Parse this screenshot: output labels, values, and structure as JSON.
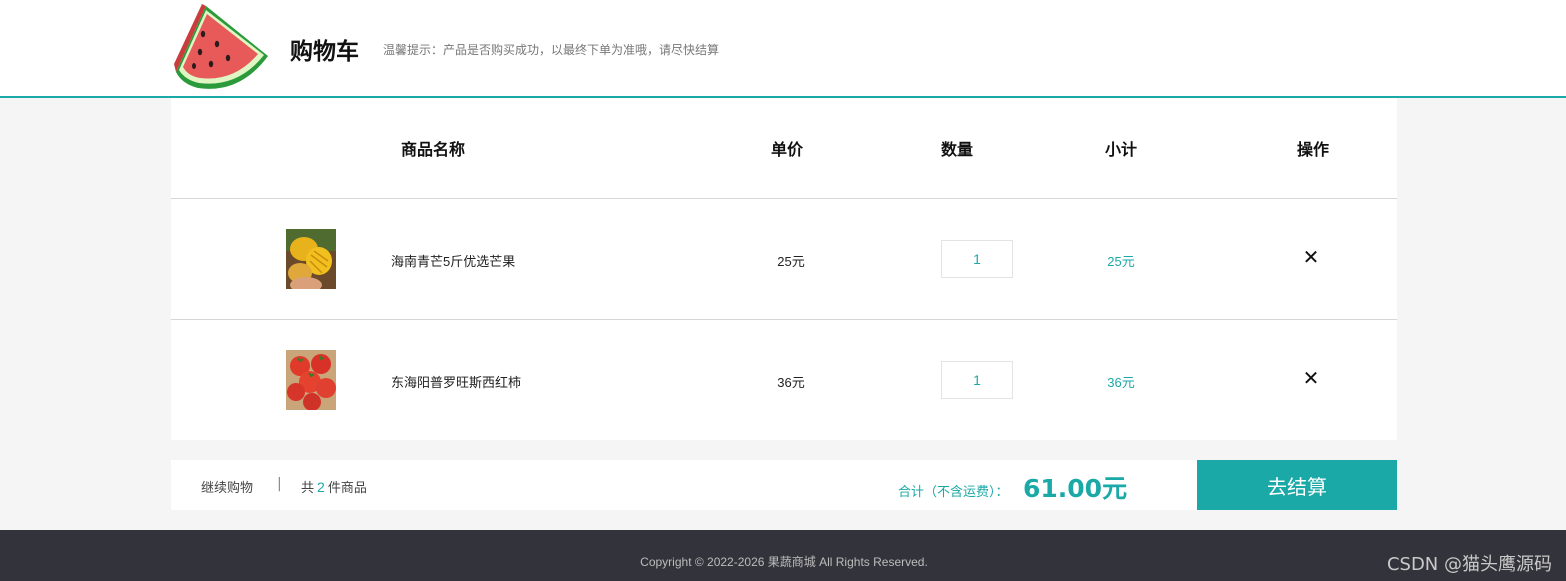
{
  "header": {
    "title": "购物车",
    "tip": "温馨提示：产品是否购买成功，以最终下单为准哦，请尽快结算",
    "logo_icon": "watermelon-icon"
  },
  "table": {
    "columns": [
      "商品名称",
      "单价",
      "数量",
      "小计",
      "操作"
    ]
  },
  "items": [
    {
      "name": "海南青芒5斤优选芒果",
      "price": "25元",
      "quantity": "1",
      "subtotal": "25元",
      "remove_icon": "close-icon",
      "image_icon": "mango-image"
    },
    {
      "name": "东海阳普罗旺斯西红柿",
      "price": "36元",
      "quantity": "1",
      "subtotal": "36元",
      "remove_icon": "close-icon",
      "image_icon": "tomato-image"
    }
  ],
  "summary": {
    "continue_label": "继续购物",
    "separator": "|",
    "count_prefix": "共",
    "count": "2",
    "count_suffix": "件商品",
    "total_label": "合计（不含运费）：",
    "total_value": "61.00元",
    "checkout_label": "去结算"
  },
  "footer": {
    "copyright": "Copyright © 2022-2026 果蔬商城 All Rights Reserved.",
    "watermark": "CSDN @猫头鹰源码"
  },
  "colors": {
    "accent": "#1aa9a7",
    "footer_bg": "#33333b",
    "page_bg": "#f5f5f5"
  }
}
